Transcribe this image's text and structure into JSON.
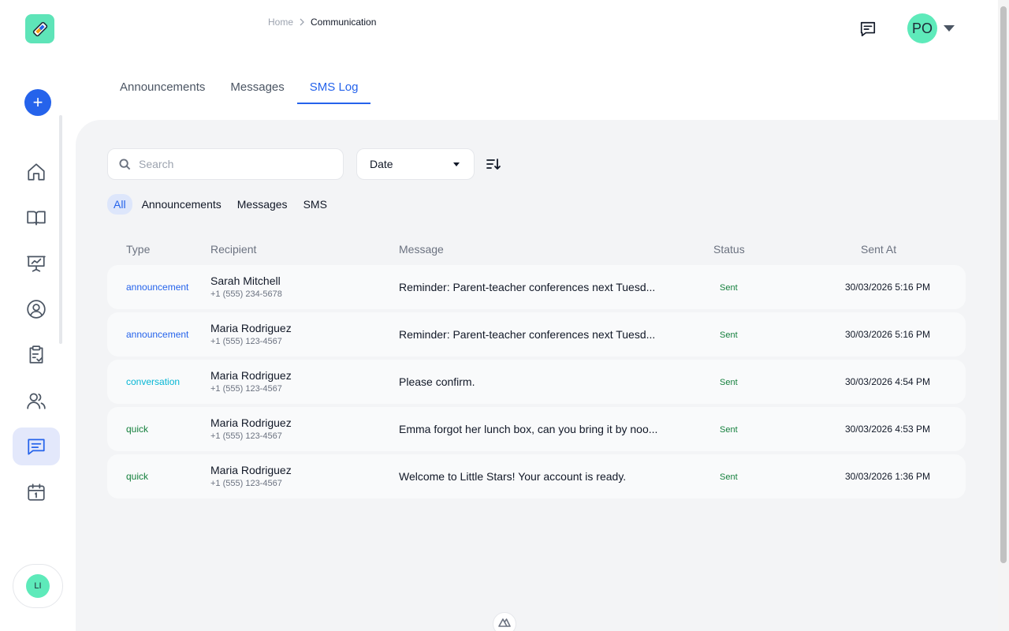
{
  "brand": {
    "logo_icon": "pencil-ruler-icon",
    "accent": "#2563eb",
    "mint": "#5eeaba"
  },
  "breadcrumb": {
    "home": "Home",
    "separator": ">",
    "current": "Communication"
  },
  "header": {
    "profile_initials": "PO"
  },
  "sidebar": {
    "add_label": "+",
    "items": [
      {
        "icon": "home-icon"
      },
      {
        "icon": "book-icon"
      },
      {
        "icon": "presentation-chart-icon"
      },
      {
        "icon": "user-circle-icon"
      },
      {
        "icon": "clipboard-check-icon"
      },
      {
        "icon": "users-icon"
      },
      {
        "icon": "message-icon",
        "active": true
      },
      {
        "icon": "calendar-icon"
      }
    ],
    "user_initials": "LI"
  },
  "tabs": [
    {
      "label": "Announcements"
    },
    {
      "label": "Messages"
    },
    {
      "label": "SMS Log",
      "active": true
    }
  ],
  "toolbar": {
    "search_placeholder": "Search",
    "sort_field": "Date"
  },
  "filters": [
    "All",
    "Announcements",
    "Messages",
    "SMS"
  ],
  "table": {
    "headers": {
      "type": "Type",
      "recipient": "Recipient",
      "message": "Message",
      "status": "Status",
      "sent_at": "Sent At"
    },
    "rows": [
      {
        "type": "announcement",
        "name": "Sarah Mitchell",
        "phone": "+1 (555) 234-5678",
        "message": "Reminder: Parent-teacher conferences next Tuesd...",
        "status": "Sent",
        "sent_at": "30/03/2026 5:16 PM"
      },
      {
        "type": "announcement",
        "name": "Maria Rodriguez",
        "phone": "+1 (555) 123-4567",
        "message": "Reminder: Parent-teacher conferences next Tuesd...",
        "status": "Sent",
        "sent_at": "30/03/2026 5:16 PM"
      },
      {
        "type": "conversation",
        "name": "Maria Rodriguez",
        "phone": "+1 (555) 123-4567",
        "message": "Please confirm.",
        "status": "Sent",
        "sent_at": "30/03/2026 4:54 PM"
      },
      {
        "type": "quick",
        "name": "Maria Rodriguez",
        "phone": "+1 (555) 123-4567",
        "message": "Emma forgot her lunch box, can you bring it by noo...",
        "status": "Sent",
        "sent_at": "30/03/2026 4:53 PM"
      },
      {
        "type": "quick",
        "name": "Maria Rodriguez",
        "phone": "+1 (555) 123-4567",
        "message": "Welcome to Little Stars! Your account is ready.",
        "status": "Sent",
        "sent_at": "30/03/2026 1:36 PM"
      }
    ]
  }
}
